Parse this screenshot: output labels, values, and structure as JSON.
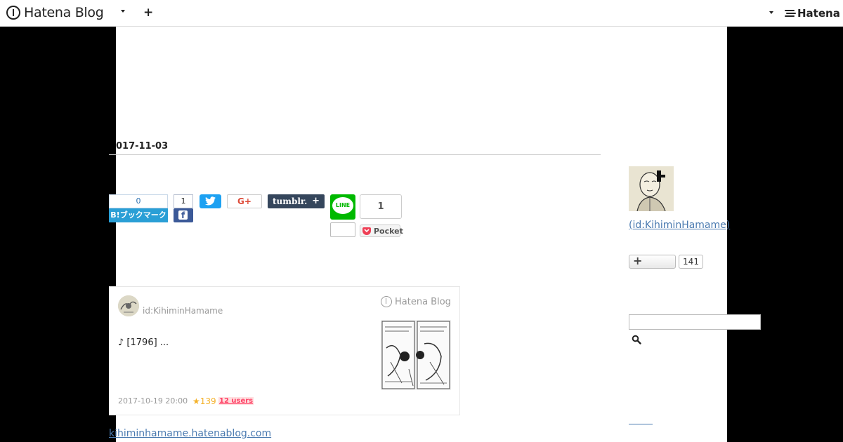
{
  "topbar": {
    "brand": "Hatena Blog",
    "hatena_logo": "Hatena",
    "icons": [
      "hatena-blog-logo-icon",
      "caret-down-icon",
      "plus-icon",
      "hatena-logo-icon"
    ]
  },
  "entry": {
    "date": "017-11-03"
  },
  "share": {
    "hatebu_count": "0",
    "hatebu_label": "B!ブックマーク",
    "facebook_count": "1",
    "facebook_label": "f",
    "googleplus_label": "G+",
    "tumblr_label": "tumblr.",
    "tumblr_plus": "+",
    "line_label": "LINE",
    "pocket_count": "1",
    "pocket_label": "Pocket"
  },
  "card": {
    "user": "id:KihiminHamame",
    "service": "Hatena Blog",
    "excerpt": "♪ [1796] ...",
    "date": "2017-10-19 20:00",
    "stars": "★139",
    "users": "12 users"
  },
  "blog_link": "kihiminhamame.hatenablog.com",
  "sidebar": {
    "profile_id": " (id:KihiminHamame)",
    "follow_label": "+",
    "follow_count": "141",
    "search_placeholder": ""
  },
  "colors": {
    "background": "#000000",
    "panel": "#ffffff",
    "link": "#4a7ab0",
    "hatebu": "#2a9fd6",
    "facebook": "#3b5998",
    "twitter": "#1da1f2",
    "tumblr": "#35465c",
    "line": "#00b900",
    "pocket": "#ef4056",
    "star": "#f4b128",
    "users_badge": "#ff4166"
  }
}
